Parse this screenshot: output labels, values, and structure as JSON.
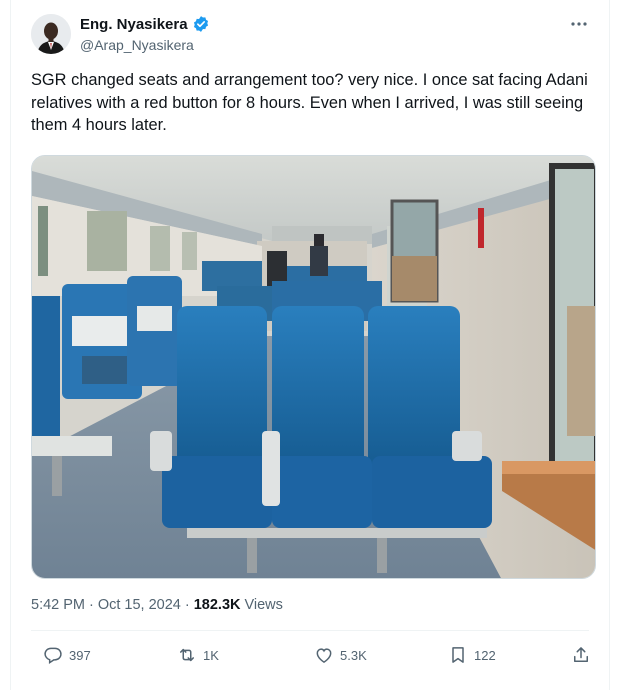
{
  "author": {
    "name": "Eng. Nyasikera",
    "handle": "@Arap_Nyasikera"
  },
  "tweet": {
    "text": "SGR changed seats and arrangement too? very nice. I once sat facing Adani relatives with a red button for 8 hours. Even when I arrived, I was still seeing them 4 hours later."
  },
  "meta": {
    "time": "5:42 PM",
    "separator": "·",
    "date": "Oct 15, 2024",
    "views_count": "182.3K",
    "views_label": "Views"
  },
  "actions": {
    "replies": "397",
    "retweets": "1K",
    "likes": "5.3K",
    "bookmarks": "122"
  },
  "colors": {
    "verified": "#1d9bf0",
    "text_primary": "#0f1419",
    "text_secondary": "#536471",
    "seat_blue": "#1e6fa8"
  }
}
